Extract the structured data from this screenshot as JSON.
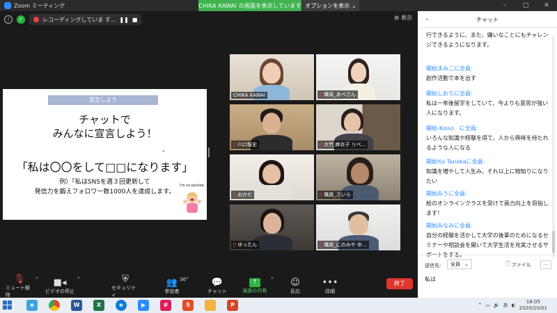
{
  "window": {
    "title": "Zoom ミーティング",
    "share_banner": "CHIKA KAWAI の画面を表示しています",
    "view_options": "オプションを表示",
    "gallery_view": "表示"
  },
  "recording": {
    "label": "レコーディングしていま す...",
    "pause_icon": "pause-icon",
    "stop_icon": "stop-icon"
  },
  "slide": {
    "tag": "宣言しよう",
    "title_line1": "チャットで",
    "title_line2": "みんなに宣言しよう！",
    "dot": "、",
    "declaration": "「私は〇〇をして□□になります」",
    "example_line1": "例）「私はSNSを週３回更新して",
    "example_line2": "発信力を鍛えフォロワー数1000人を達成します。",
    "image_caption": "I'm so excited."
  },
  "participants": [
    {
      "name": "CHIKA KAWAI",
      "muted": false,
      "active": true
    },
    {
      "name": "職員_あべさん",
      "muted": true,
      "active": false
    },
    {
      "name": "川口智史",
      "muted": true,
      "active": false
    },
    {
      "name": "大竹 麻衣子 リベ...",
      "muted": true,
      "active": false
    },
    {
      "name": "おかだ",
      "muted": true,
      "active": false
    },
    {
      "name": "職員_さいら",
      "muted": true,
      "active": false
    },
    {
      "name": "ゆったん",
      "muted": true,
      "active": false
    },
    {
      "name": "職員_にのみや ゆ...",
      "muted": true,
      "active": false
    }
  ],
  "toolbar": {
    "mute": "ミュート解除",
    "video": "ビデオの停止",
    "security": "セキュリティ",
    "participants": "参加者",
    "participant_count": "36",
    "chat": "チャット",
    "share": "画面の共有",
    "reactions": "反応",
    "more": "詳細",
    "end": "終了"
  },
  "chat": {
    "title": "チャット",
    "messages": [
      {
        "from": "",
        "text": "行できるように、また、嫌いなことにもチャレンジできるようになります。"
      },
      {
        "from": "開始まみこに全員:",
        "text": "創作活動で本を出す"
      },
      {
        "from": "開始しおりに全員:",
        "text": "私は一年後留学をしていて、今よりも意思が強い人になります。"
      },
      {
        "from": "開始-Koiso　に全員:",
        "text": "いろんな知識や経験を得て、人から興味を持たれるような人になる"
      },
      {
        "from": "開始Yui Tanakaに全員:",
        "text": "知識を増やして人生み、それ以上に物知りになりたい"
      },
      {
        "from": "開始みうに全員:",
        "text": "絵のオンラインクラスを受けて画力向上を目指します！"
      },
      {
        "from": "開始みなみに全員:",
        "text": "自分の経験を活かして大学の後輩のためになるセミナーや相談会を開いて大学生活を充実させるサポートをする。"
      }
    ],
    "to_label": "送信先:",
    "to_value": "全員",
    "file": "ファイル",
    "more": "…",
    "input_value": "私は"
  },
  "taskbar": {
    "time": "18:05",
    "date": "2020/10/01",
    "ime": "あ"
  },
  "colors": {
    "share_green": "#3fb34f",
    "end_red": "#e0362c",
    "chat_blue": "#2d8cff",
    "active_outline": "#c8e04d"
  }
}
